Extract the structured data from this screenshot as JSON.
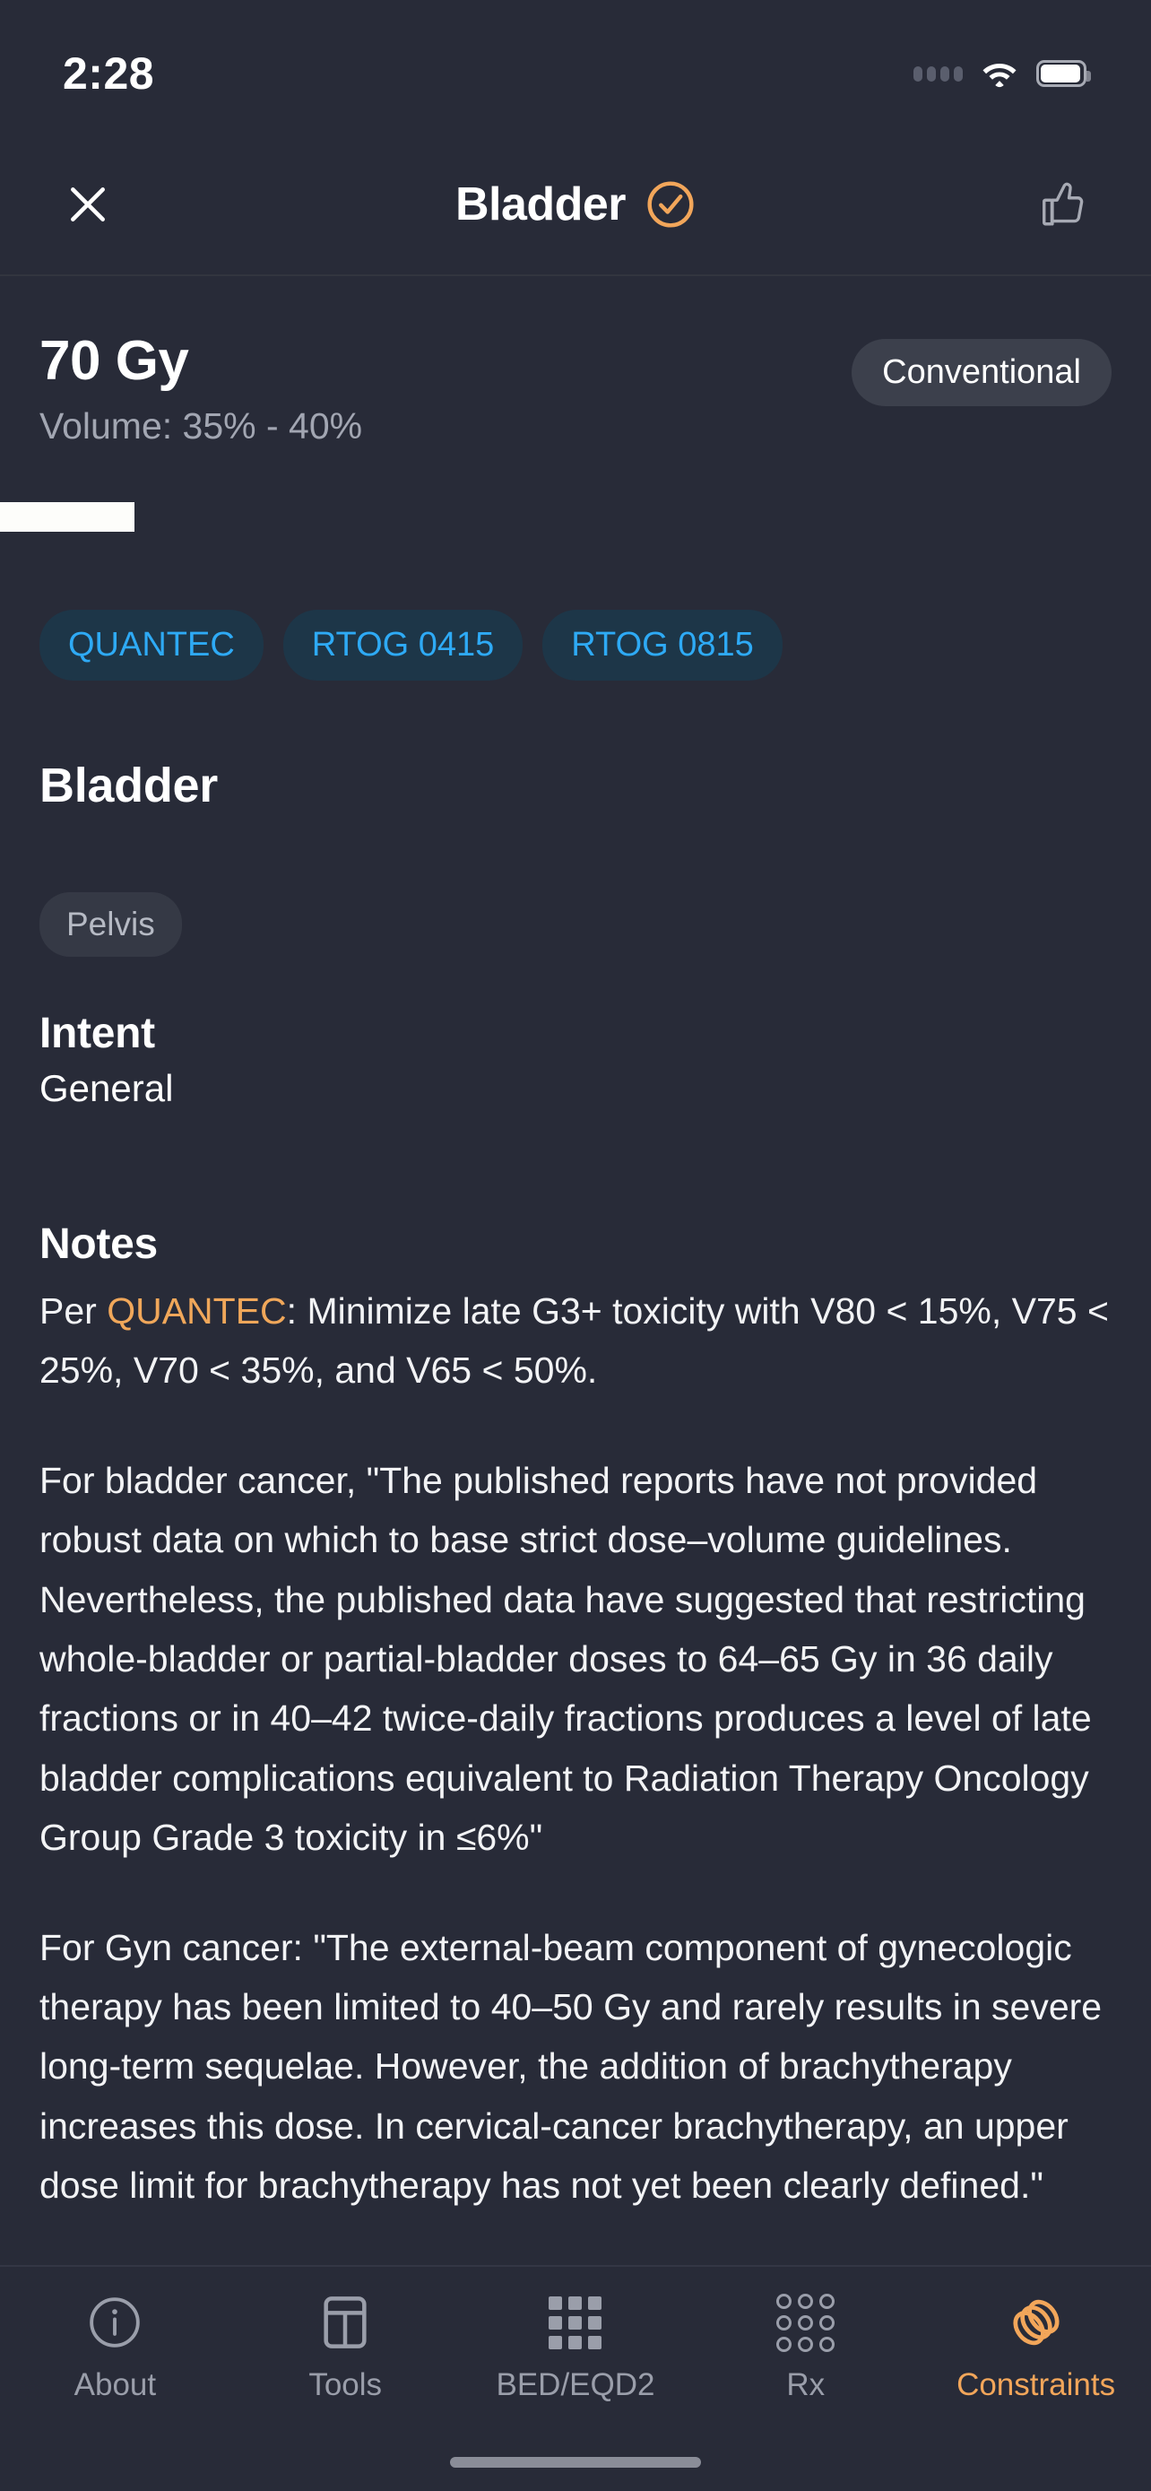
{
  "status_bar": {
    "time": "2:28",
    "signal_icon": "signal-dots-icon",
    "wifi_icon": "wifi-icon",
    "battery_icon": "battery-icon"
  },
  "nav_bar": {
    "close_icon": "close-icon",
    "title": "Bladder",
    "verified_icon": "verified-check-circle-icon",
    "thumbs_up_icon": "thumbs-up-icon"
  },
  "dose": {
    "value": "70 Gy",
    "volume": "Volume: 35% - 40%",
    "modality": "Conventional"
  },
  "tags": [
    {
      "label": "QUANTEC"
    },
    {
      "label": "RTOG 0415"
    },
    {
      "label": "RTOG 0815"
    }
  ],
  "organ": {
    "name": "Bladder",
    "region": "Pelvis"
  },
  "intent": {
    "heading": "Intent",
    "value": "General"
  },
  "notes": {
    "heading": "Notes",
    "para1_prefix": "Per ",
    "para1_highlight": "QUANTEC",
    "para1_rest": ": Minimize late G3+ toxicity with V80 < 15%, V75 < 25%, V70 < 35%, and V65 < 50%.",
    "para2": "For bladder cancer, \"The published reports have not provided robust data on which to base strict dose–volume guidelines. Nevertheless, the published data have suggested that restricting whole-bladder or partial-bladder doses to 64–65 Gy in 36 daily fractions or in 40–42 twice-daily fractions produces a level of late bladder complications equivalent to Radiation Therapy Oncology Group Grade 3 toxicity in ≤6%\"",
    "para3": "For Gyn cancer: \"The external-beam component of gynecologic therapy has been limited to 40–50 Gy and rarely results in severe long-term sequelae. However, the addition of brachytherapy increases this dose. In cervical-cancer brachytherapy, an upper dose limit for brachytherapy has not yet been clearly defined.\""
  },
  "tab_bar": {
    "items": [
      {
        "label": "About",
        "icon": "info-circle-icon",
        "active": false
      },
      {
        "label": "Tools",
        "icon": "layout-panel-icon",
        "active": false
      },
      {
        "label": "BED/EQD2",
        "icon": "grid-squares-icon",
        "active": false
      },
      {
        "label": "Rx",
        "icon": "grid-circles-icon",
        "active": false
      },
      {
        "label": "Constraints",
        "icon": "rings-icon",
        "active": true
      }
    ]
  },
  "colors": {
    "background": "#282b38",
    "accent_orange": "#f2a65a",
    "tag_blue": "#2eaaf5",
    "tag_blue_bg": "#1d3648",
    "muted_text": "#9a9eaa"
  }
}
